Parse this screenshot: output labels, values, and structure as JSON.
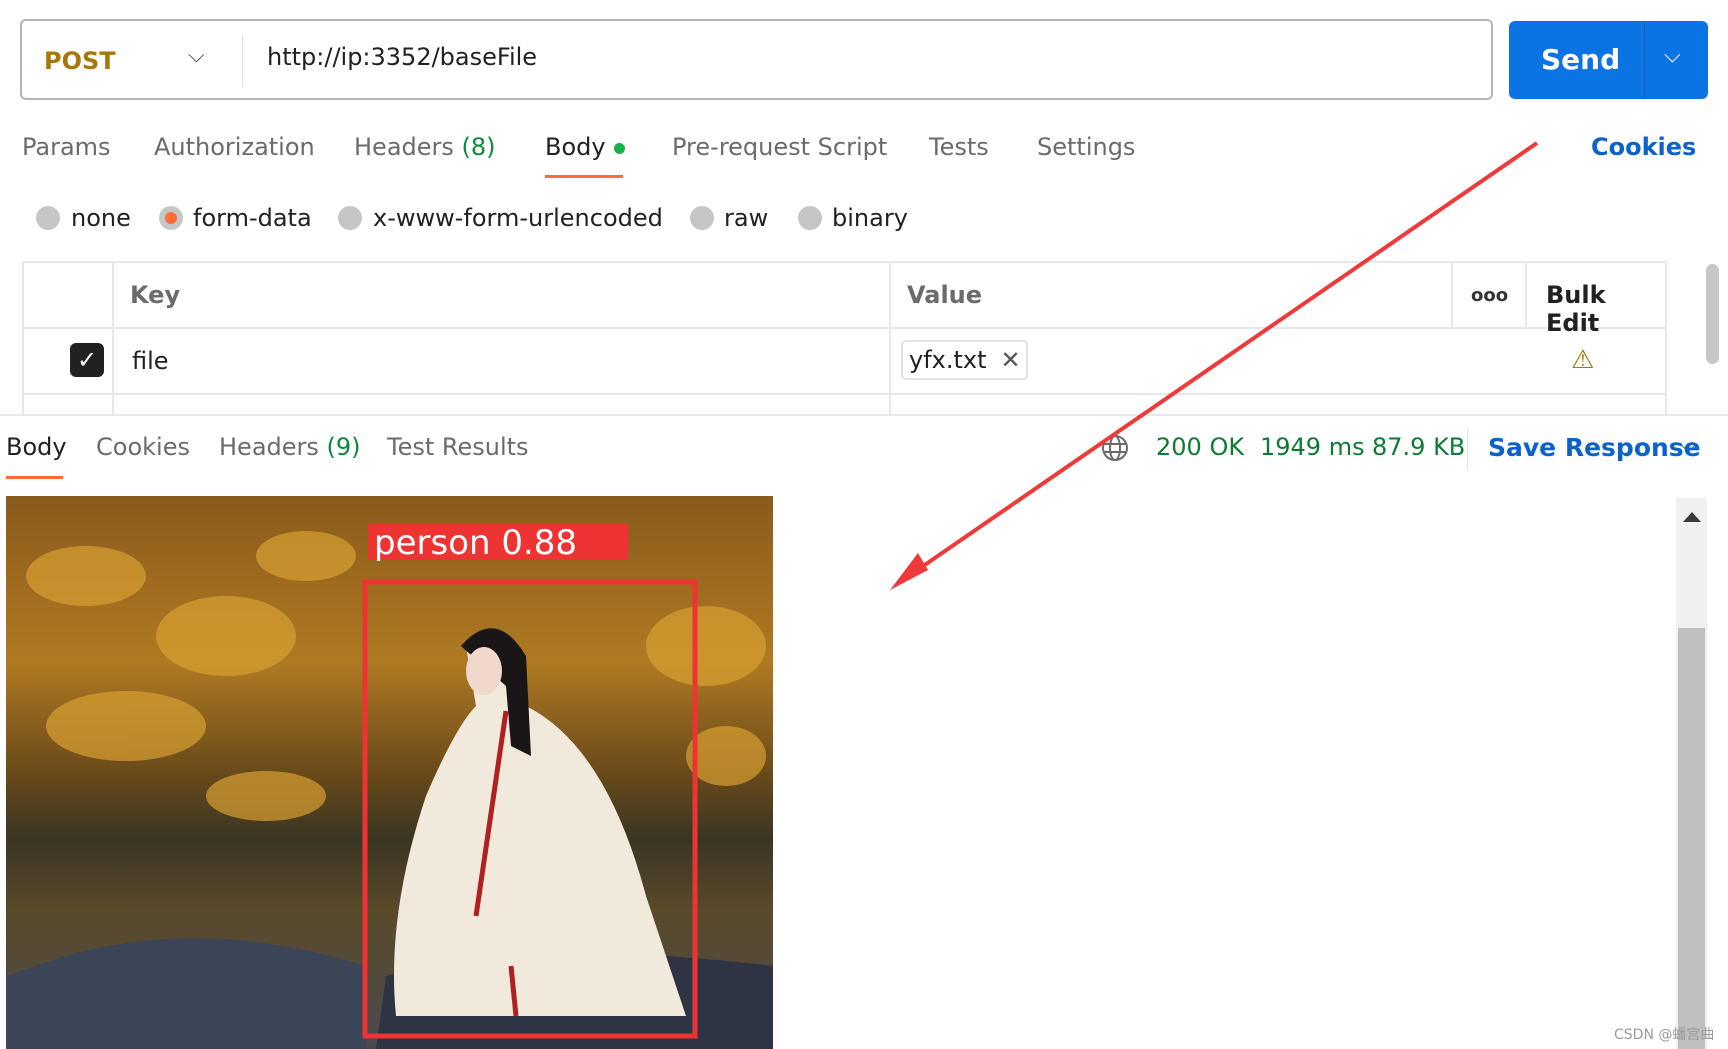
{
  "request": {
    "method": "POST",
    "url": "http://ip:3352/baseFile",
    "send_label": "Send"
  },
  "request_tabs": [
    {
      "label": "Params"
    },
    {
      "label": "Authorization"
    },
    {
      "label": "Headers",
      "count": "(8)"
    },
    {
      "label": "Body",
      "active": true
    },
    {
      "label": "Pre-request Script"
    },
    {
      "label": "Tests"
    },
    {
      "label": "Settings"
    }
  ],
  "cookies_link": "Cookies",
  "body_types": [
    "none",
    "form-data",
    "x-www-form-urlencoded",
    "raw",
    "binary"
  ],
  "body_type_selected": "form-data",
  "form_table": {
    "headers": {
      "key": "Key",
      "value": "Value",
      "bulk_edit": "Bulk Edit"
    },
    "rows": [
      {
        "checked": true,
        "key": "file",
        "value": "yfx.txt"
      }
    ]
  },
  "response": {
    "tabs": [
      {
        "label": "Body",
        "active": true
      },
      {
        "label": "Cookies"
      },
      {
        "label": "Headers",
        "count": "(9)"
      },
      {
        "label": "Test Results"
      }
    ],
    "status": "200 OK",
    "time": "1949 ms",
    "size": "87.9 KB",
    "save_label": "Save Response",
    "image_detection_label": "person 0.88"
  },
  "watermark": "CSDN @蟠宫曲",
  "colors": {
    "accent": "#ff6c37",
    "send": "#0b74e5",
    "link": "#0b63c9",
    "success": "#0a7d32",
    "annotation_arrow": "#f03a3a"
  }
}
